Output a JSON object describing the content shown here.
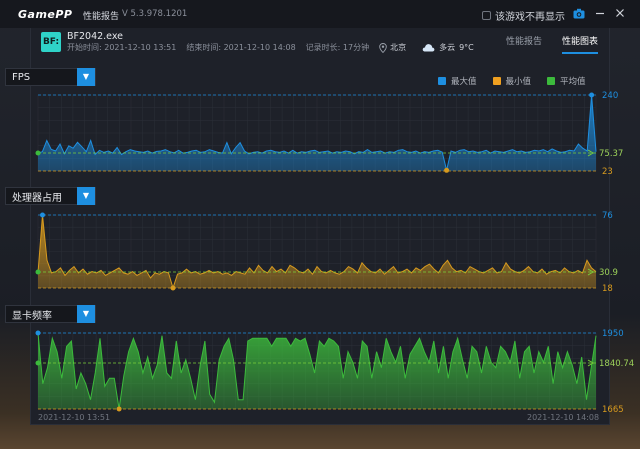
{
  "app": {
    "logo_game": "Game",
    "logo_pp": "PP",
    "title": "性能报告",
    "version": "V 5.3.978.1201",
    "dont_show": "该游戏不再显示"
  },
  "session": {
    "badge": "BF:",
    "exe": "BF2042.exe",
    "start": "开始时间: 2021-12-10 13:51",
    "end": "结束时间: 2021-12-10 14:08",
    "duration": "记录时长: 17分钟",
    "city": "北京",
    "weather": "多云",
    "temp": "9°C"
  },
  "tabs": [
    {
      "label": "性能报告",
      "active": false
    },
    {
      "label": "性能图表",
      "active": true
    }
  ],
  "legend": [
    {
      "label": "最大值",
      "color": "#1e8fe0"
    },
    {
      "label": "最小值",
      "color": "#f0a020"
    },
    {
      "label": "平均值",
      "color": "#3cba3c"
    }
  ],
  "dates": {
    "start": "2021-12-10 13:51",
    "end": "2021-12-10 14:08"
  },
  "chart_data": [
    {
      "type": "area",
      "title": "FPS",
      "max_label": "240",
      "avg_label": "75.37",
      "min_label": "23",
      "max": 240,
      "avg": 75.37,
      "min": 23,
      "color": "#1e8fe0",
      "values": [
        75,
        78,
        110,
        85,
        80,
        100,
        72,
        95,
        88,
        105,
        92,
        78,
        110,
        70,
        82,
        76,
        80,
        74,
        90,
        70,
        78,
        84,
        80,
        78,
        76,
        80,
        74,
        79,
        80,
        84,
        78,
        75,
        82,
        74,
        76,
        80,
        82,
        76,
        78,
        84,
        80,
        76,
        74,
        104,
        72,
        90,
        104,
        80,
        72,
        76,
        78,
        74,
        80,
        82,
        78,
        76,
        80,
        74,
        82,
        74,
        78,
        76,
        80,
        82,
        76,
        78,
        80,
        74,
        78,
        76,
        80,
        78,
        72,
        78,
        76,
        84,
        76,
        78,
        80,
        74,
        78,
        76,
        82,
        84,
        78,
        76,
        80,
        74,
        78,
        76,
        80,
        82,
        77,
        25,
        80,
        76,
        82,
        84,
        78,
        80,
        76,
        78,
        82,
        74,
        80,
        78,
        76,
        80,
        84,
        78,
        80,
        76,
        78,
        82,
        80,
        84,
        78,
        86,
        80,
        76,
        78,
        82,
        80,
        100,
        88,
        80,
        240,
        78
      ]
    },
    {
      "type": "area",
      "title": "处理器占用",
      "max_label": "76",
      "avg_label": "30.9",
      "min_label": "18",
      "max": 76,
      "avg": 30.9,
      "min": 18,
      "color": "#d79a1e",
      "values": [
        30,
        76,
        40,
        30,
        31,
        34,
        28,
        32,
        35,
        30,
        33,
        29,
        31,
        30,
        32,
        28,
        30,
        32,
        34,
        30,
        29,
        31,
        28,
        30,
        32,
        26,
        30,
        29,
        31,
        30,
        18,
        29,
        30,
        33,
        30,
        31,
        29,
        30,
        32,
        30,
        31,
        29,
        30,
        28,
        31,
        30,
        29,
        34,
        30,
        36,
        32,
        30,
        35,
        31,
        33,
        30,
        36,
        34,
        31,
        30,
        33,
        29,
        35,
        31,
        30,
        32,
        30,
        29,
        31,
        35,
        33,
        30,
        38,
        34,
        31,
        30,
        33,
        29,
        32,
        35,
        30,
        31,
        33,
        30,
        34,
        32,
        35,
        37,
        33,
        30,
        36,
        40,
        34,
        31,
        32,
        30,
        35,
        33,
        31,
        30,
        32,
        34,
        30,
        31,
        38,
        33,
        31,
        30,
        32,
        35,
        31,
        30,
        33,
        29,
        31,
        32,
        30,
        34,
        31,
        30,
        32,
        30,
        40,
        34,
        31
      ]
    },
    {
      "type": "area",
      "title": "显卡频率",
      "max_label": "1950",
      "avg_label": "1840.74",
      "min_label": "1665",
      "max": 1950,
      "avg": 1840.74,
      "min": 1665,
      "color": "#3cba3c",
      "values": [
        1950,
        1760,
        1820,
        1930,
        1880,
        1780,
        1900,
        1920,
        1740,
        1800,
        1760,
        1700,
        1800,
        1930,
        1750,
        1780,
        1780,
        1665,
        1790,
        1880,
        1930,
        1880,
        1800,
        1860,
        1780,
        1830,
        1940,
        1800,
        1780,
        1920,
        1800,
        1850,
        1780,
        1700,
        1830,
        1920,
        1720,
        1690,
        1850,
        1900,
        1930,
        1850,
        1700,
        1700,
        1920,
        1930,
        1930,
        1930,
        1930,
        1900,
        1930,
        1930,
        1930,
        1900,
        1930,
        1920,
        1930,
        1870,
        1800,
        1920,
        1900,
        1930,
        1920,
        1900,
        1780,
        1880,
        1840,
        1780,
        1920,
        1900,
        1780,
        1880,
        1820,
        1930,
        1880,
        1840,
        1900,
        1780,
        1870,
        1900,
        1930,
        1880,
        1840,
        1920,
        1800,
        1900,
        1780,
        1880,
        1930,
        1850,
        1780,
        1900,
        1880,
        1800,
        1900,
        1840,
        1820,
        1900,
        1880,
        1840,
        1920,
        1780,
        1880,
        1900,
        1800,
        1880,
        1840,
        1900,
        1760,
        1880,
        1820,
        1880,
        1830,
        1760,
        1860,
        1700,
        1820,
        1940
      ]
    }
  ]
}
